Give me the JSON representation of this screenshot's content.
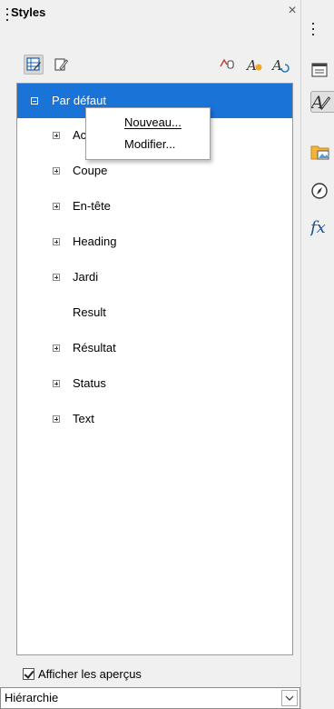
{
  "panel": {
    "title": "Styles",
    "close_glyph": "×"
  },
  "toolbar": {
    "left_icons": [
      "hierarchical-list-icon",
      "style-list-icon"
    ],
    "right_icons": [
      "fill-format-mode-icon",
      "new-style-from-selection-icon",
      "update-style-icon"
    ]
  },
  "tree": {
    "items": [
      {
        "label": "Par défaut",
        "expander": "minus",
        "selected": true
      },
      {
        "label": "Accent",
        "expander": "plus"
      },
      {
        "label": "Coupe",
        "expander": "plus"
      },
      {
        "label": "En-tête",
        "expander": "plus"
      },
      {
        "label": "Heading",
        "expander": "plus"
      },
      {
        "label": "Jardi",
        "expander": "plus"
      },
      {
        "label": "Result",
        "expander": "none"
      },
      {
        "label": "Résultat",
        "expander": "plus"
      },
      {
        "label": "Status",
        "expander": "plus"
      },
      {
        "label": "Text",
        "expander": "plus"
      }
    ]
  },
  "context_menu": {
    "items": [
      {
        "label": "Nouveau...",
        "mnemonic": "N"
      },
      {
        "label": "Modifier...",
        "mnemonic": "M"
      }
    ]
  },
  "preview_checkbox": {
    "label": "Afficher les aperçus",
    "checked": true
  },
  "filter_select": {
    "value": "Hiérarchie"
  },
  "sidebar_deck": {
    "buttons": [
      "properties-icon",
      "styles-icon",
      "gallery-icon",
      "navigator-icon",
      "functions-icon"
    ],
    "active": "styles-icon"
  },
  "colors": {
    "selection": "#1a73d6",
    "background": "#f0f0f0"
  }
}
